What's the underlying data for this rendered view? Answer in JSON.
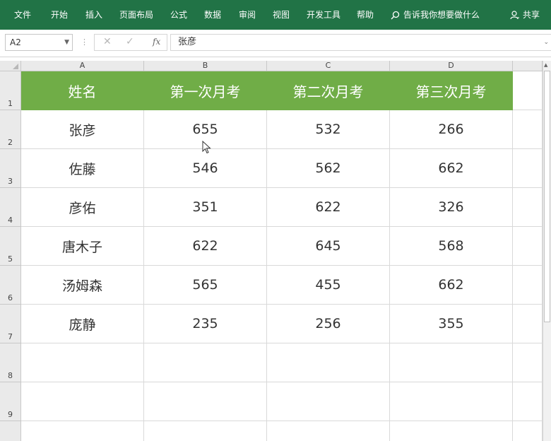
{
  "ribbon": {
    "tabs": [
      "文件",
      "开始",
      "插入",
      "页面布局",
      "公式",
      "数据",
      "审阅",
      "视图",
      "开发工具",
      "帮助"
    ],
    "tell_me": "告诉我你想要做什么",
    "share": "共享"
  },
  "formula_bar": {
    "name_box": "A2",
    "formula": "张彦",
    "fx_label": "fx"
  },
  "sheet": {
    "columns": [
      "A",
      "B",
      "C",
      "D"
    ],
    "rows": [
      "1",
      "2",
      "3",
      "4",
      "5",
      "6",
      "7",
      "8",
      "9"
    ],
    "header": [
      "姓名",
      "第一次月考",
      "第二次月考",
      "第三次月考"
    ],
    "data": [
      [
        "张彦",
        "655",
        "532",
        "266"
      ],
      [
        "佐藤",
        "546",
        "562",
        "662"
      ],
      [
        "彦佑",
        "351",
        "622",
        "326"
      ],
      [
        "唐木子",
        "622",
        "645",
        "568"
      ],
      [
        "汤姆森",
        "565",
        "455",
        "662"
      ],
      [
        "庞静",
        "235",
        "256",
        "355"
      ]
    ],
    "header_color": "#70ad47",
    "ribbon_color": "#217346"
  }
}
